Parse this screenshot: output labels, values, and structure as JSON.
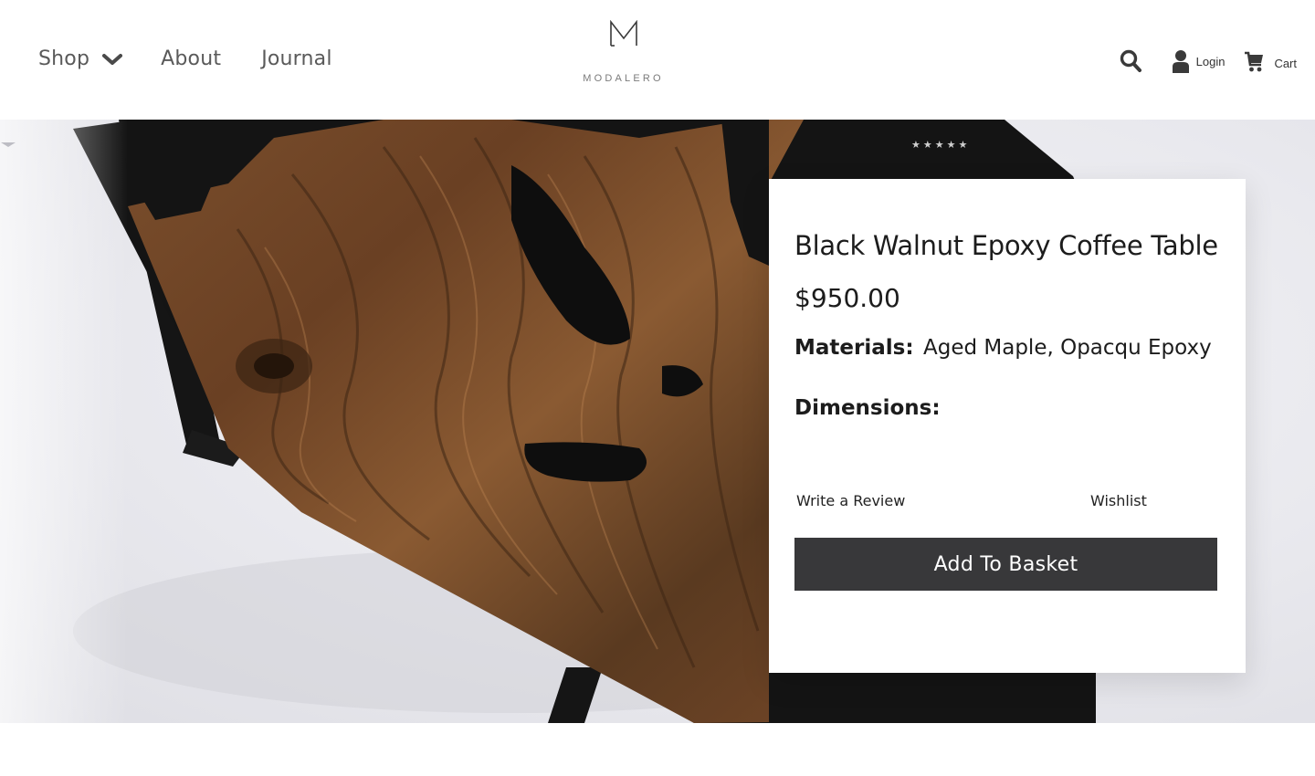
{
  "nav": {
    "shop_label": "Shop",
    "about_label": "About",
    "journal_label": "Journal"
  },
  "brand": {
    "name": "MODALERO"
  },
  "header_actions": {
    "login_label": "Login",
    "cart_label": "Cart"
  },
  "hero": {
    "rating_stars": "★★★★★"
  },
  "product": {
    "title": "Black Walnut Epoxy Coffee Table",
    "price": "$950.00",
    "materials_label": "Materials:",
    "materials_value": "Aged Maple, Opacqu Epoxy",
    "dimensions_label": "Dimensions:",
    "write_review_label": "Write a Review",
    "wishlist_label": "Wishlist",
    "add_to_basket_label": "Add To Basket"
  },
  "colors": {
    "button_bg": "#38383a",
    "nav_text": "#5a5a5a"
  },
  "icons": {
    "shop_dropdown": "chevron-down-icon",
    "search": "search-icon",
    "login": "user-icon",
    "cart": "cart-icon",
    "logo": "logo-m-icon"
  }
}
